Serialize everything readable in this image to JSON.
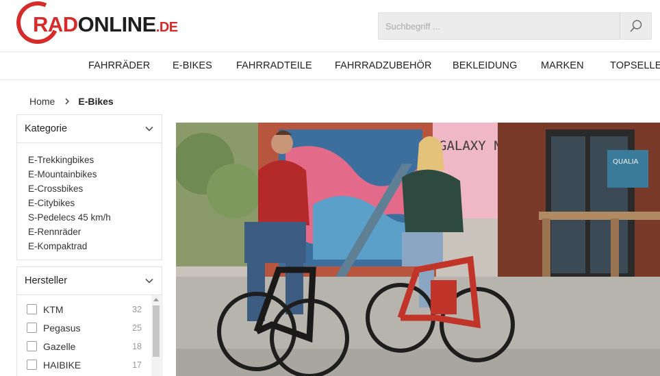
{
  "brand": {
    "rad": "RAD",
    "online": "ONLINE",
    "tld": ".DE"
  },
  "search": {
    "placeholder": "Suchbegriff ...",
    "value": ""
  },
  "nav": {
    "items": [
      "FAHRRÄDER",
      "E-BIKES",
      "FAHRRADTEILE",
      "FAHRRADZUBEHÖR",
      "BEKLEIDUNG",
      "MARKEN",
      "TOPSELLER"
    ]
  },
  "breadcrumb": {
    "home": "Home",
    "current": "E-Bikes"
  },
  "category_filter": {
    "title": "Kategorie",
    "items": [
      "E-Trekkingbikes",
      "E-Mountainbikes",
      "E-Crossbikes",
      "E-Citybikes",
      "S-Pedelecs 45 km/h",
      "E-Rennräder",
      "E-Kompaktrad"
    ]
  },
  "brand_filter": {
    "title": "Hersteller",
    "items": [
      {
        "name": "KTM",
        "count": "32",
        "checked": false
      },
      {
        "name": "Pegasus",
        "count": "25",
        "checked": false
      },
      {
        "name": "Gazelle",
        "count": "18",
        "checked": false
      },
      {
        "name": "HAIBIKE",
        "count": "17",
        "checked": false
      }
    ]
  },
  "hero": {
    "sign_text": "GALAXY NIGHT.",
    "sticker_text": "QUALIA"
  },
  "colors": {
    "brand_red": "#d52b2b",
    "text_dark": "#1e1e1e",
    "border": "#e2e2e2"
  }
}
